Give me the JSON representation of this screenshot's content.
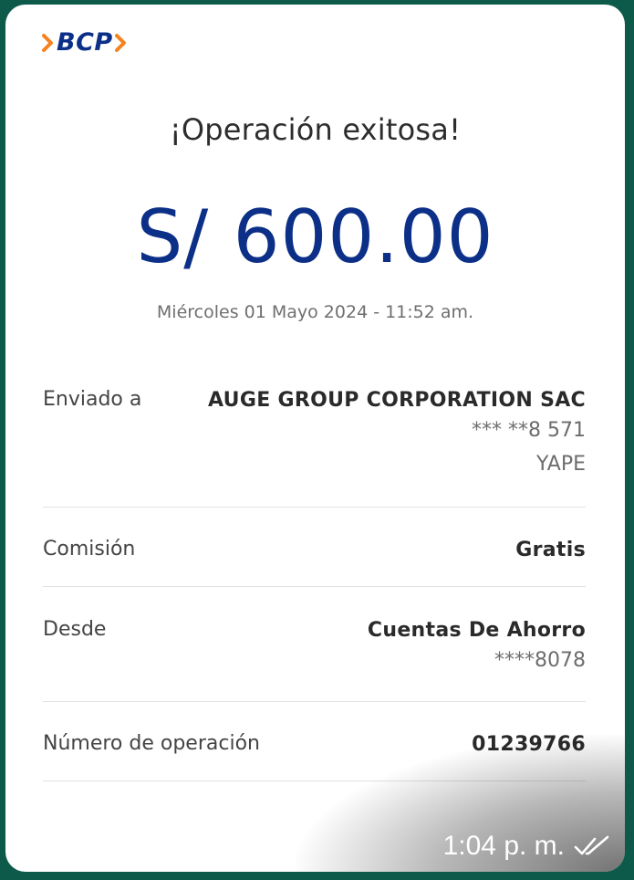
{
  "brand": {
    "name": "BCP",
    "accent_color": "#f5821f",
    "primary_color": "#0c2f87"
  },
  "receipt": {
    "title": "¡Operación exitosa!",
    "amount": "S/ 600.00",
    "datetime": "Miércoles 01 Mayo 2024 - 11:52 am."
  },
  "details": {
    "sent_to": {
      "label": "Enviado a",
      "name": "AUGE GROUP CORPORATION SAC",
      "phone": "*** **8 571",
      "channel": "YAPE"
    },
    "commission": {
      "label": "Comisión",
      "value": "Gratis"
    },
    "from": {
      "label": "Desde",
      "account_type": "Cuentas De Ahorro",
      "account_number": "****8078"
    },
    "operation": {
      "label": "Número de operación",
      "value": "01239766"
    }
  },
  "message": {
    "time": "1:04 p. m.",
    "status_icon": "double-check-icon"
  }
}
